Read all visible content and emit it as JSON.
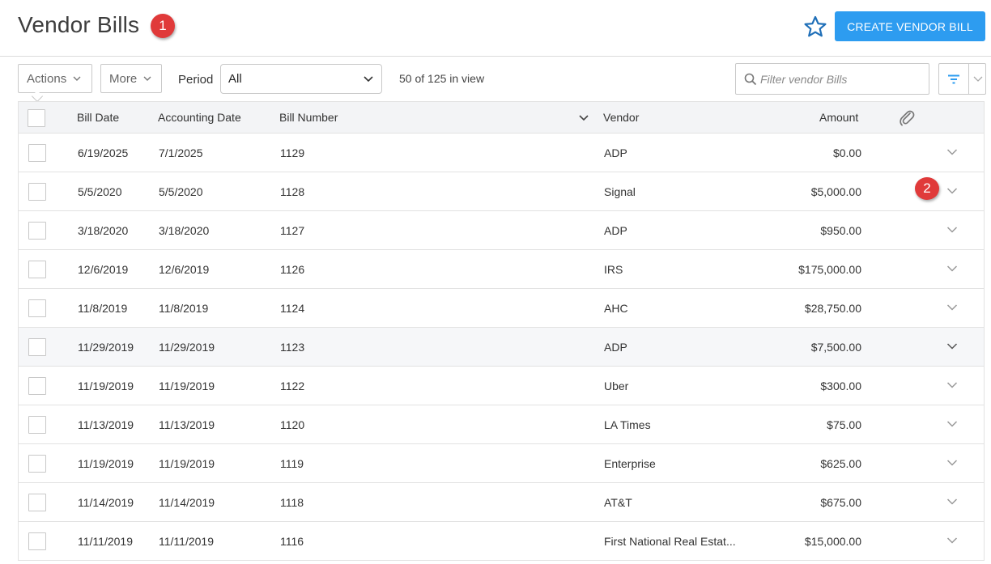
{
  "header": {
    "title": "Vendor Bills",
    "create_button": "CREATE VENDOR BILL",
    "callout_1": "1",
    "callout_2": "2"
  },
  "toolbar": {
    "actions_label": "Actions",
    "more_label": "More",
    "period_label": "Period",
    "period_value": "All",
    "count_text": "50 of 125 in view",
    "search_placeholder": "Filter vendor Bills"
  },
  "table": {
    "columns": {
      "bill_date": "Bill Date",
      "accounting_date": "Accounting Date",
      "bill_number": "Bill Number",
      "vendor": "Vendor",
      "amount": "Amount"
    },
    "rows": [
      {
        "bill_date": "6/19/2025",
        "accounting_date": "7/1/2025",
        "bill_number": "1129",
        "vendor": "ADP",
        "amount": "$0.00"
      },
      {
        "bill_date": "5/5/2020",
        "accounting_date": "5/5/2020",
        "bill_number": "1128",
        "vendor": "Signal",
        "amount": "$5,000.00"
      },
      {
        "bill_date": "3/18/2020",
        "accounting_date": "3/18/2020",
        "bill_number": "1127",
        "vendor": "ADP",
        "amount": "$950.00"
      },
      {
        "bill_date": "12/6/2019",
        "accounting_date": "12/6/2019",
        "bill_number": "1126",
        "vendor": "IRS",
        "amount": "$175,000.00"
      },
      {
        "bill_date": "11/8/2019",
        "accounting_date": "11/8/2019",
        "bill_number": "1124",
        "vendor": "AHC",
        "amount": "$28,750.00"
      },
      {
        "bill_date": "11/29/2019",
        "accounting_date": "11/29/2019",
        "bill_number": "1123",
        "vendor": "ADP",
        "amount": "$7,500.00"
      },
      {
        "bill_date": "11/19/2019",
        "accounting_date": "11/19/2019",
        "bill_number": "1122",
        "vendor": "Uber",
        "amount": "$300.00"
      },
      {
        "bill_date": "11/13/2019",
        "accounting_date": "11/13/2019",
        "bill_number": "1120",
        "vendor": "LA Times",
        "amount": "$75.00"
      },
      {
        "bill_date": "11/19/2019",
        "accounting_date": "11/19/2019",
        "bill_number": "1119",
        "vendor": "Enterprise",
        "amount": "$625.00"
      },
      {
        "bill_date": "11/14/2019",
        "accounting_date": "11/14/2019",
        "bill_number": "1118",
        "vendor": "AT&T",
        "amount": "$675.00"
      },
      {
        "bill_date": "11/11/2019",
        "accounting_date": "11/11/2019",
        "bill_number": "1116",
        "vendor": "First National Real Estat...",
        "amount": "$15,000.00"
      }
    ]
  },
  "colors": {
    "accent": "#2d9cf0",
    "callout": "#e03a3a",
    "star": "#1f6fb8"
  }
}
